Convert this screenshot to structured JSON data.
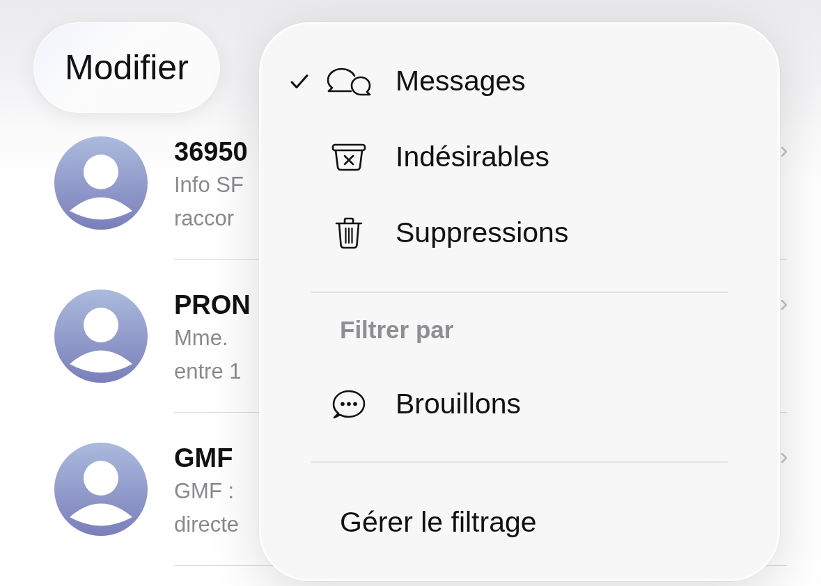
{
  "toolbar": {
    "edit_button": "Modifier"
  },
  "conversations": [
    {
      "name": "36950",
      "preview_lines": [
        "Info SF",
        "raccor"
      ]
    },
    {
      "name": "PRON",
      "preview_lines": [
        "Mme.",
        "entre 1"
      ]
    },
    {
      "name": "GMF",
      "preview_lines": [
        "GMF :",
        "directe"
      ]
    }
  ],
  "filter_menu": {
    "sections": [
      {
        "items": [
          {
            "kind": "option",
            "label": "Messages",
            "selected": true
          },
          {
            "kind": "option",
            "label": "Indésirables",
            "selected": false
          },
          {
            "kind": "option",
            "label": "Suppressions",
            "selected": false
          }
        ]
      },
      {
        "header": "Filtrer par",
        "items": [
          {
            "kind": "option",
            "label": "Brouillons",
            "selected": false
          }
        ]
      },
      {
        "items": [
          {
            "kind": "action",
            "label": "Gérer le filtrage"
          }
        ]
      }
    ]
  }
}
